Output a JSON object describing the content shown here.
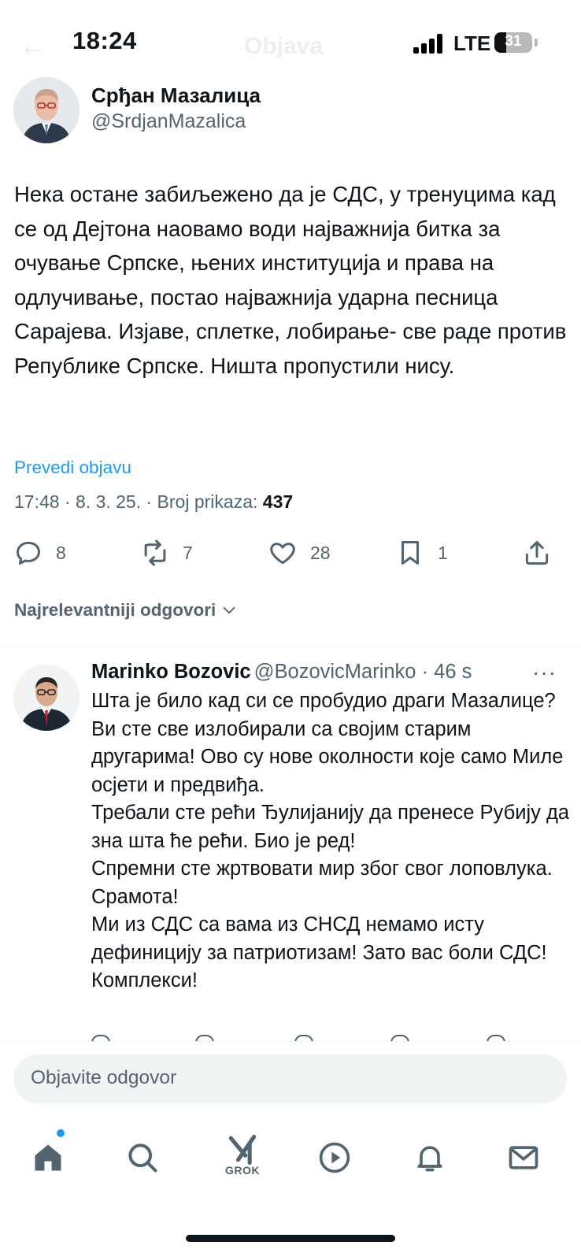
{
  "status_bar": {
    "time": "18:24",
    "network": "LTE",
    "battery": "31",
    "battery_level": 0.31
  },
  "nav": {
    "title": "Objava"
  },
  "post": {
    "author_name": "Срђан Мазалица",
    "author_handle": "@SrdjanMazalica",
    "text": "Нека остане забиљежено да је СДС, у тренуцима кад се од Дејтона наовамо води најважнија битка за очување Српске, њених институција и права на одлучивање, постао најважнија ударна песница Сарајева. Изјаве, сплетке, лобирање- све раде против Републике Српске. Ништа пропустили нису.",
    "translate": "Prevedi objavu",
    "meta": "17:48 · 8. 3. 25. · Broj prikaza: ",
    "views": "437",
    "replies": "8",
    "reposts": "7",
    "likes": "28",
    "bookmarks": "1"
  },
  "replies_sort": "Najrelevantniji odgovori",
  "reply": {
    "name": "Marinko Bozovic",
    "handle": "@BozovicMarinko · 46 s",
    "more": "···",
    "text": "Шта је било кад си се пробудио драги Мазалице?\nВи сте све излобирали са својим старим другарима! Ово су нове околности које само Миле осјети и предвиђа.\nТребали сте рећи Ђулијанију да пренесе Рубију да зна шта ће рећи. Био је ред!\nСпремни сте жртвовати мир због свог лоповлука. Срамота!\nМи из СДС са вама из СНСД немамо исту дефиницију за патриотизам! Зато вас боли СДС! Комплекси!"
  },
  "compose": {
    "placeholder": "Objavite odgovor"
  },
  "bottom_nav": {
    "grok_label": "GROK",
    "items": [
      "home-icon",
      "search-icon",
      "grok-icon",
      "play-icon",
      "bell-icon",
      "mail-icon"
    ]
  },
  "colors": {
    "accent": "#1d9bf0",
    "text": "#0f1419",
    "secondary": "#536471"
  }
}
